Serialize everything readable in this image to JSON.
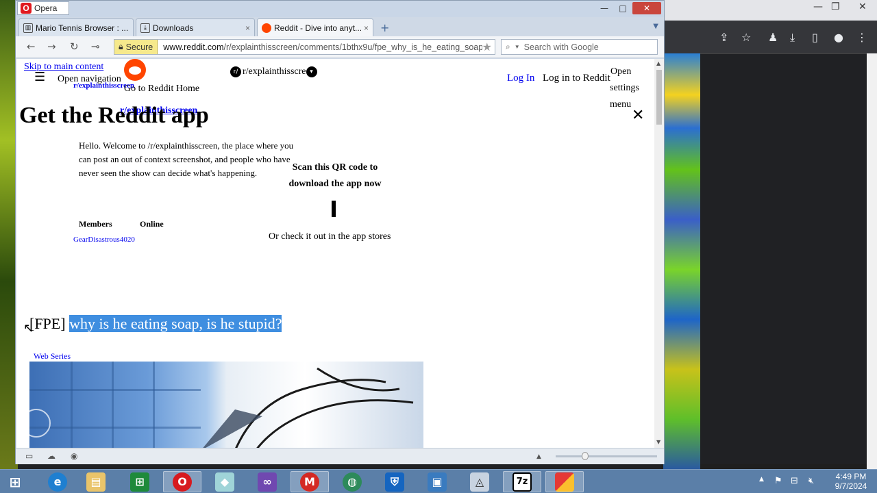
{
  "opera": {
    "app_name": "Opera",
    "tabs": [
      {
        "label": "Mario Tennis Browser : ...",
        "close": "×"
      },
      {
        "label": "Downloads",
        "close": "×"
      },
      {
        "label": "Reddit - Dive into anyt...",
        "close": "×"
      }
    ],
    "new_tab": "+",
    "nav": {
      "back": "←",
      "forward": "→",
      "reload": "↻",
      "key": "⊸"
    },
    "security_label": "Secure",
    "url_host": "www.reddit.com",
    "url_path": "/r/explainthisscreen/comments/1bthx9u/fpe_why_is_he_eating_soap_",
    "search_placeholder": "Search with Google"
  },
  "page": {
    "skip_link": "Skip to main content",
    "open_navigation": "Open navigation",
    "subreddit_link_1": "r/explainthisscreen",
    "go_home": "Go to Reddit Home",
    "subreddit_link_2": "r/explainthisscreen",
    "subreddit_header": "r/explainthisscre",
    "log_in": "Log In",
    "log_in_to_reddit": "Log in to Reddit",
    "open_settings": "Open",
    "open_settings_2": "settings",
    "open_settings_3": "menu",
    "close_x": "✕",
    "app_heading": "Get the Reddit app",
    "welcome": "Hello. Welcome to /r/explainthisscreen, the place where you can post an out of context screenshot, and people who have never seen the show can decide what's happening.",
    "qr_title": "Scan this QR code to download the app now",
    "app_stores": "Or check it out in the app stores",
    "members_label": "Members",
    "online_label": "Online",
    "user_link": "GearDisastrous4020",
    "flair_prefix": "[FPE]",
    "post_title": "why is he eating soap, is he stupid?",
    "flair_link": "Web Series"
  },
  "taskbar": {
    "time": "4:49 PM",
    "date": "9/7/2024"
  },
  "colors": {
    "reddit_orange": "#ff4500",
    "selection": "#3f8ee0",
    "link": "#0000ee"
  }
}
